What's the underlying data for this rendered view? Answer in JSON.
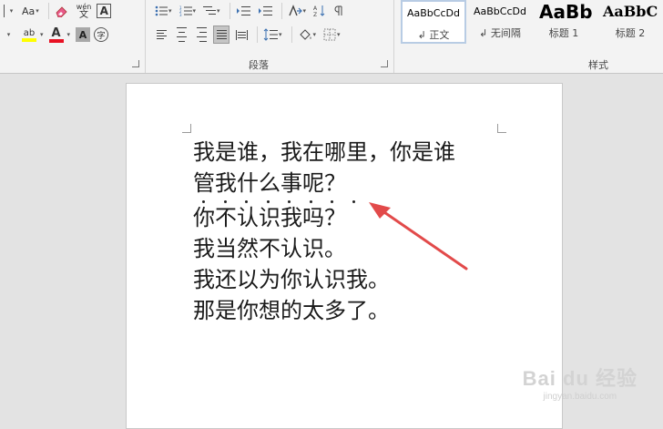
{
  "ribbon": {
    "font_group": {
      "row1": {
        "clear_format_label": "Aa",
        "phonetic_guide_label": "wén"
      },
      "row2": {
        "highlight_label": "ab",
        "font_color_label": "A",
        "char_shading_label": "A",
        "enclose_char_label": "字"
      }
    },
    "paragraph_group": {
      "label": "段落"
    },
    "styles_group": {
      "label": "样式",
      "styles": [
        {
          "sample": "AaBbCcDd",
          "name": "正文",
          "selected": true
        },
        {
          "sample": "AaBbCcDd",
          "name": "无间隔",
          "selected": false
        },
        {
          "sample": "AaBb",
          "name": "标题 1",
          "selected": false
        },
        {
          "sample": "AaBbC",
          "name": "标题 2",
          "selected": false
        }
      ]
    },
    "colors": {
      "highlight": "#ffff00",
      "font_color": "#e81123",
      "selected_tile_border": "#b8cce4"
    }
  },
  "document": {
    "lines": [
      "我是谁，我在哪里，你是谁",
      "管我什么事呢？",
      "你不认识我吗？",
      "我当然不认识。",
      "我还以为你认识我。",
      "那是你想的太多了。"
    ],
    "emphasis_dot_count": 8
  },
  "annotation": {
    "arrow_color": "#e24a4a"
  },
  "watermark": {
    "brand": "Bai du 经验",
    "url": "jingyan.baidu.com"
  }
}
